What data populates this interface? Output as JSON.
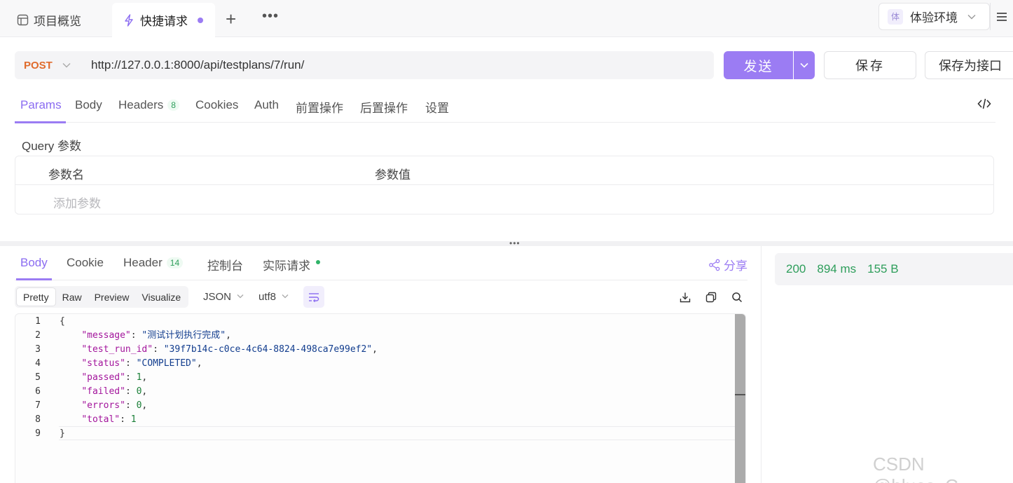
{
  "top_tabs": {
    "overview_label": "项目概览",
    "quick_label": "快捷请求",
    "add": "+",
    "more": "•••"
  },
  "env": {
    "badge": "体",
    "label": "体验环境"
  },
  "request": {
    "method": "POST",
    "url": "http://127.0.0.1:8000/api/testplans/7/run/",
    "send_label": "发送",
    "save_label": "保存",
    "save_as_label": "保存为接口"
  },
  "req_tabs": {
    "params": "Params",
    "body": "Body",
    "headers": "Headers",
    "headers_count": "8",
    "cookies": "Cookies",
    "auth": "Auth",
    "pre": "前置操作",
    "post": "后置操作",
    "settings": "设置"
  },
  "params": {
    "title": "Query 参数",
    "col_name": "参数名",
    "col_value": "参数值",
    "add_placeholder": "添加参数"
  },
  "resp_tabs": {
    "body": "Body",
    "cookie": "Cookie",
    "header": "Header",
    "header_count": "14",
    "console": "控制台",
    "actual": "实际请求",
    "share": "分享"
  },
  "resp_toolbar": {
    "formats": [
      "Pretty",
      "Raw",
      "Preview",
      "Visualize"
    ],
    "lang": "JSON",
    "encoding": "utf8"
  },
  "response_body": {
    "lines": [
      {
        "no": "1",
        "key": "",
        "value": "{",
        "type": "brace",
        "comma": false
      },
      {
        "no": "2",
        "key": "\"message\"",
        "value": "\"测试计划执行完成\"",
        "type": "string",
        "comma": true
      },
      {
        "no": "3",
        "key": "\"test_run_id\"",
        "value": "\"39f7b14c-c0ce-4c64-8824-498ca7e99ef2\"",
        "type": "string",
        "comma": true
      },
      {
        "no": "4",
        "key": "\"status\"",
        "value": "\"COMPLETED\"",
        "type": "string",
        "comma": true
      },
      {
        "no": "5",
        "key": "\"passed\"",
        "value": "1",
        "type": "number",
        "comma": true
      },
      {
        "no": "6",
        "key": "\"failed\"",
        "value": "0",
        "type": "number",
        "comma": true
      },
      {
        "no": "7",
        "key": "\"errors\"",
        "value": "0",
        "type": "number",
        "comma": true
      },
      {
        "no": "8",
        "key": "\"total\"",
        "value": "1",
        "type": "number",
        "comma": false
      },
      {
        "no": "9",
        "key": "",
        "value": "}",
        "type": "brace",
        "comma": false
      }
    ]
  },
  "status": {
    "code": "200",
    "time": "894 ms",
    "size": "155 B"
  },
  "watermark": "CSDN @blues_C",
  "colors": {
    "accent": "#9b7cf3",
    "success": "#2e9e5b",
    "method_post": "#e06b2c"
  }
}
